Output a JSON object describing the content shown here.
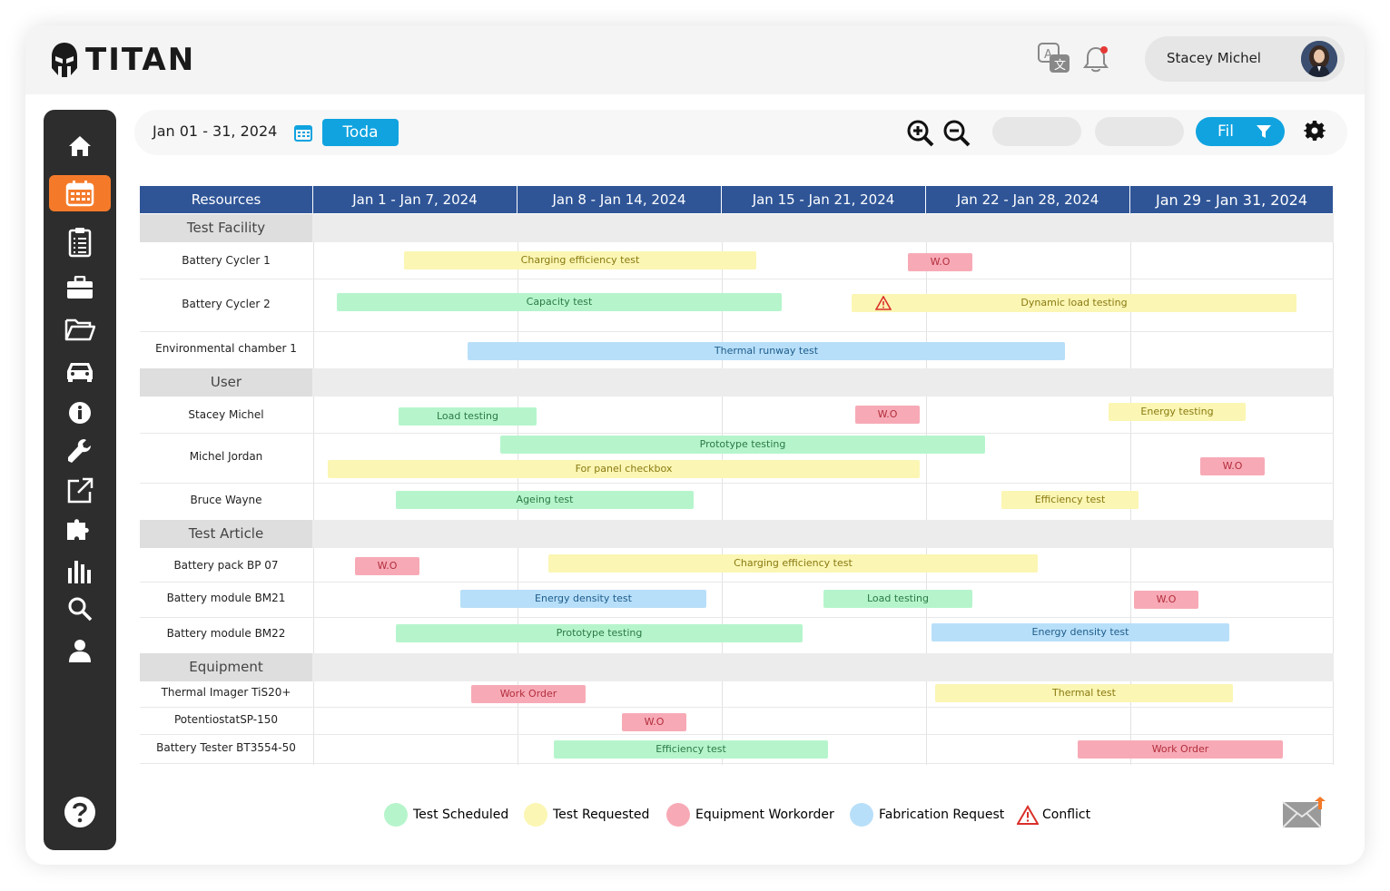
{
  "app": {
    "name": "TITAN"
  },
  "user": {
    "name": "Stacey Michel"
  },
  "icons": {
    "translate": "translate-icon",
    "bell": "bell-icon"
  },
  "toolbar": {
    "date_range": "Jan 01 - 31, 2024",
    "today_label": "Toda",
    "filter_label": "Fil"
  },
  "sidebar": {
    "items": [
      "home-icon",
      "calendar-icon",
      "clipboard-icon",
      "briefcase-icon",
      "folder-icon",
      "car-icon",
      "info-icon",
      "wrench-icon",
      "external-link-icon",
      "puzzle-icon",
      "bar-chart-icon",
      "search-icon",
      "user-icon"
    ],
    "active": "calendar-icon"
  },
  "columns": {
    "resources": "Resources",
    "weeks": [
      "Jan 1 - Jan 7, 2024",
      "Jan 8 - Jan 14, 2024",
      "Jan 15 - Jan 21, 2024",
      "Jan 22 - Jan 28, 2024",
      "Jan 29 - Jan 31, 2024"
    ]
  },
  "sections": [
    {
      "title": "Test Facility",
      "rows": [
        {
          "label": "Battery Cycler 1",
          "bars": [
            {
              "label": "Charging efficiency test",
              "type": "test-requested"
            },
            {
              "label": "W.O",
              "type": "equipment-workorder"
            }
          ]
        },
        {
          "label": "Battery Cycler 2",
          "bars": [
            {
              "label": "Capacity test",
              "type": "test-scheduled"
            },
            {
              "label": "Dynamic load testing",
              "type": "test-requested",
              "conflict": true
            }
          ]
        },
        {
          "label": "Environmental chamber 1",
          "bars": [
            {
              "label": "Thermal runway test",
              "type": "fabrication-request"
            }
          ]
        }
      ]
    },
    {
      "title": "User",
      "rows": [
        {
          "label": "Stacey Michel",
          "bars": [
            {
              "label": "Load testing",
              "type": "test-scheduled"
            },
            {
              "label": "W.O",
              "type": "equipment-workorder"
            },
            {
              "label": "Energy testing",
              "type": "test-requested"
            }
          ]
        },
        {
          "label": "Michel Jordan",
          "bars": [
            {
              "label": "Prototype testing",
              "type": "test-scheduled"
            },
            {
              "label": "For panel checkbox",
              "type": "test-requested"
            },
            {
              "label": "W.O",
              "type": "equipment-workorder"
            }
          ]
        },
        {
          "label": "Bruce Wayne",
          "bars": [
            {
              "label": "Ageing test",
              "type": "test-scheduled"
            },
            {
              "label": "Efficiency test",
              "type": "test-requested"
            }
          ]
        }
      ]
    },
    {
      "title": "Test Article",
      "rows": [
        {
          "label": "Battery pack BP 07",
          "bars": [
            {
              "label": "W.O",
              "type": "equipment-workorder"
            },
            {
              "label": "Charging efficiency test",
              "type": "test-requested"
            }
          ]
        },
        {
          "label": "Battery module BM21",
          "bars": [
            {
              "label": "Energy density test",
              "type": "fabrication-request"
            },
            {
              "label": "Load testing",
              "type": "test-scheduled"
            },
            {
              "label": "W.O",
              "type": "equipment-workorder"
            }
          ]
        },
        {
          "label": "Battery module BM22",
          "bars": [
            {
              "label": "Prototype testing",
              "type": "test-scheduled"
            },
            {
              "label": "Energy density test",
              "type": "fabrication-request"
            }
          ]
        }
      ]
    },
    {
      "title": "Equipment",
      "rows": [
        {
          "label": "Thermal Imager TiS20+",
          "bars": [
            {
              "label": "Work Order",
              "type": "equipment-workorder"
            },
            {
              "label": "Thermal test",
              "type": "test-requested"
            }
          ]
        },
        {
          "label": "PotentiostatSP-150",
          "bars": [
            {
              "label": "W.O",
              "type": "equipment-workorder"
            }
          ]
        },
        {
          "label": "Battery Tester BT3554-50",
          "bars": [
            {
              "label": "Efficiency test",
              "type": "test-scheduled"
            },
            {
              "label": "Work Order",
              "type": "equipment-workorder"
            }
          ]
        }
      ]
    }
  ],
  "legend": [
    {
      "label": "Test Scheduled",
      "color": "#b6f5cc"
    },
    {
      "label": "Test Requested",
      "color": "#fbf6b3"
    },
    {
      "label": "Equipment Workorder",
      "color": "#f7aab6"
    },
    {
      "label": "Fabrication Request",
      "color": "#b8dff9"
    },
    {
      "label": "Conflict",
      "color": "#d9302a"
    }
  ],
  "colors": {
    "header": "#2f5597",
    "accent": "#10a3e0",
    "active_nav": "#f47a2a",
    "sidebar": "#2d2d2d"
  }
}
